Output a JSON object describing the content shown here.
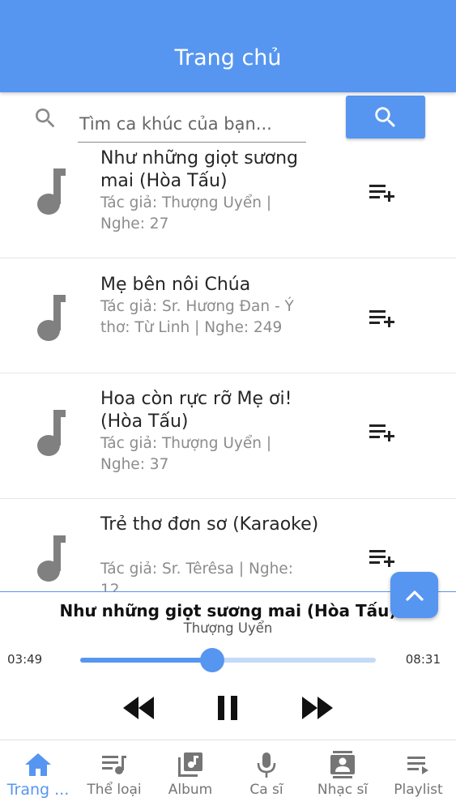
{
  "app_bar": {
    "title": "Trang chủ"
  },
  "search": {
    "placeholder": "Tìm ca khúc của bạn...",
    "value": ""
  },
  "songs": [
    {
      "title": "Như những giọt sương mai (Hòa Tấu)",
      "subtitle": "Tác giả: Thượng Uyển | Nghe: 27"
    },
    {
      "title": "Mẹ bên nôi Chúa",
      "subtitle": "Tác giả: Sr. Hương Đan - Ý thơ: Từ Linh | Nghe: 249"
    },
    {
      "title": "Hoa còn rực rỡ Mẹ ơi! (Hòa Tấu)",
      "subtitle": "Tác giả: Thượng Uyển | Nghe: 37"
    },
    {
      "title": "Trẻ thơ đơn sơ (Karaoke)",
      "subtitle": "Tác giả: Sr. Têrêsa | Nghe: 12"
    }
  ],
  "player": {
    "title": "Như những giọt sương mai (Hòa Tấu)",
    "artist": "Thượng Uyển",
    "current_time": "03:49",
    "total_time": "08:31",
    "progress_fraction": 0.447
  },
  "bottom_nav": [
    {
      "label": "Trang ...",
      "icon": "home-icon",
      "active": true
    },
    {
      "label": "Thể loại",
      "icon": "queue-music-icon",
      "active": false
    },
    {
      "label": "Album",
      "icon": "library-music-icon",
      "active": false
    },
    {
      "label": "Ca sĩ",
      "icon": "mic-icon",
      "active": false
    },
    {
      "label": "Nhạc sĩ",
      "icon": "contact-card-icon",
      "active": false
    },
    {
      "label": "Playlist",
      "icon": "playlist-play-icon",
      "active": false
    }
  ],
  "colors": {
    "primary": "#5696f0",
    "track_background": "#c4daf8",
    "icon_grey": "#757575"
  }
}
